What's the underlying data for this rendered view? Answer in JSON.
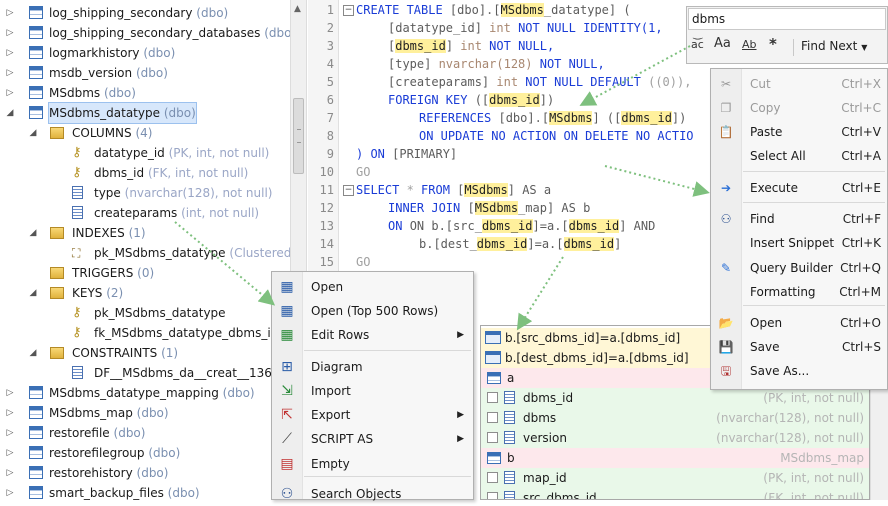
{
  "tree": {
    "rows": [
      {
        "label": "log_shipping_secondary",
        "sub": "(dbo)"
      },
      {
        "label": "log_shipping_secondary_databases",
        "sub": "(dbo)"
      },
      {
        "label": "logmarkhistory",
        "sub": "(dbo)"
      },
      {
        "label": "msdb_version",
        "sub": "(dbo)"
      },
      {
        "label": "MSdbms",
        "sub": "(dbo)"
      },
      {
        "label": "MSdbms_datatype",
        "sub": "(dbo)"
      },
      {
        "label": "COLUMNS",
        "sub": "(4)"
      },
      {
        "label": "datatype_id",
        "sub": "(PK, int, not null)"
      },
      {
        "label": "dbms_id",
        "sub": "(FK, int, not null)"
      },
      {
        "label": "type",
        "sub": "(nvarchar(128), not null)"
      },
      {
        "label": "createparams",
        "sub": "(int, not null)"
      },
      {
        "label": "INDEXES",
        "sub": "(1)"
      },
      {
        "label": "pk_MSdbms_datatype",
        "sub": "(Clustered)"
      },
      {
        "label": "TRIGGERS",
        "sub": "(0)"
      },
      {
        "label": "KEYS",
        "sub": "(2)"
      },
      {
        "label": "pk_MSdbms_datatype",
        "sub": ""
      },
      {
        "label": "fk_MSdbms_datatype_dbms_id",
        "sub": ""
      },
      {
        "label": "CONSTRAINTS",
        "sub": "(1)"
      },
      {
        "label": "DF__MSdbms_da__creat__1367E",
        "sub": ""
      },
      {
        "label": "MSdbms_datatype_mapping",
        "sub": "(dbo)"
      },
      {
        "label": "MSdbms_map",
        "sub": "(dbo)"
      },
      {
        "label": "restorefile",
        "sub": "(dbo)"
      },
      {
        "label": "restorefilegroup",
        "sub": "(dbo)"
      },
      {
        "label": "restorehistory",
        "sub": "(dbo)"
      },
      {
        "label": "smart_backup_files",
        "sub": "(dbo)"
      }
    ]
  },
  "editor": {
    "line_numbers": [
      "1",
      "2",
      "3",
      "4",
      "5",
      "6",
      "7",
      "8",
      "9",
      "10",
      "11",
      "12",
      "13",
      "14",
      "15"
    ],
    "l1": {
      "a": "CREATE TABLE ",
      "b": "[dbo]",
      "c": ".",
      "d": "[",
      "e": "MSdbms",
      "f": "_datatype] ("
    },
    "l2": {
      "a": "[datatype_id] ",
      "b": "int",
      "c": " NOT NULL IDENTITY(1,"
    },
    "l3": {
      "a": "[",
      "b": "dbms_id",
      "c": "] ",
      "d": "int",
      "e": " NOT NULL,"
    },
    "l4": {
      "a": "[type] ",
      "b": "nvarchar(128)",
      "c": " NOT NULL,"
    },
    "l5": {
      "a": "[createparams] ",
      "b": "int",
      "c": " NOT NULL DEFAULT ",
      "d": "((0)),"
    },
    "l6": {
      "a": "FOREIGN KEY ",
      "b": "([",
      "c": "dbms_id",
      "d": "])"
    },
    "l7": {
      "a": "REFERENCES ",
      "b": "[dbo]",
      "c": ".",
      "d": "[",
      "e": "MSdbms",
      "f": "] ([",
      "g": "dbms_id",
      "h": "])"
    },
    "l8": {
      "a": "ON UPDATE NO ACTION ON DELETE NO ACTIO"
    },
    "l9": {
      "a": ") ON ",
      "b": "[PRIMARY]"
    },
    "l10": {
      "a": "GO"
    },
    "l11": {
      "a": "SELECT ",
      "b": "* ",
      "c": "FROM ",
      "d": "[",
      "e": "MSdbms",
      "f": "] AS a"
    },
    "l12": {
      "a": "INNER JOIN ",
      "b": "[",
      "c": "MSdbms",
      "d": "_map] AS b"
    },
    "l13": {
      "a": "ON b.[src_",
      "b": "dbms_id",
      "c": "]=a.[",
      "d": "dbms_id",
      "e": "] AND"
    },
    "l14": {
      "a": "b.[dest_",
      "b": "dbms_id",
      "c": "]=a.[",
      "d": "dbms_id",
      "e": "]"
    },
    "l15": {
      "a": "GO"
    }
  },
  "find": {
    "value": "dbms",
    "match_case_icon": "Aa",
    "whole_word_icon": "Ab",
    "regex_icon": "*",
    "find_next_label": "Find Next"
  },
  "context_menu": [
    {
      "label": "Cut",
      "shortcut": "Ctrl+X",
      "icon": "scissors-icon",
      "disabled": true
    },
    {
      "label": "Copy",
      "shortcut": "Ctrl+C",
      "icon": "copy-icon",
      "disabled": true
    },
    {
      "label": "Paste",
      "shortcut": "Ctrl+V",
      "icon": "paste-icon",
      "disabled": false
    },
    {
      "label": "Select All",
      "shortcut": "Ctrl+A",
      "icon": "",
      "disabled": false
    },
    {
      "label": "Execute",
      "shortcut": "Ctrl+E",
      "icon": "execute-icon",
      "disabled": false
    },
    {
      "label": "Find",
      "shortcut": "Ctrl+F",
      "icon": "binoculars-icon",
      "disabled": false
    },
    {
      "label": "Insert Snippet",
      "shortcut": "Ctrl+K",
      "icon": "",
      "disabled": false
    },
    {
      "label": "Query Builder",
      "shortcut": "Ctrl+Q",
      "icon": "query-builder-icon",
      "disabled": false
    },
    {
      "label": "Formatting",
      "shortcut": "Ctrl+M",
      "icon": "",
      "disabled": false
    },
    {
      "label": "Open",
      "shortcut": "Ctrl+O",
      "icon": "folder-icon",
      "disabled": false
    },
    {
      "label": "Save",
      "shortcut": "Ctrl+S",
      "icon": "save-icon",
      "disabled": false
    },
    {
      "label": "Save As...",
      "shortcut": "",
      "icon": "save-as-icon",
      "disabled": false
    }
  ],
  "table_menu": [
    {
      "label": "Open",
      "icon": "open-table-icon",
      "submenu": false
    },
    {
      "label": "Open (Top 500 Rows)",
      "icon": "open-top-rows-icon",
      "submenu": false
    },
    {
      "label": "Edit Rows",
      "icon": "edit-rows-icon",
      "submenu": true
    },
    {
      "label": "Diagram",
      "icon": "diagram-icon",
      "submenu": false
    },
    {
      "label": "Import",
      "icon": "import-icon",
      "submenu": false
    },
    {
      "label": "Export",
      "icon": "export-icon",
      "submenu": true
    },
    {
      "label": "SCRIPT AS",
      "icon": "script-icon",
      "submenu": true
    },
    {
      "label": "Empty",
      "icon": "empty-table-icon",
      "submenu": false
    },
    {
      "label": "Search Objects",
      "icon": "search-objects-icon",
      "submenu": false
    }
  ],
  "join_popup": {
    "conditions": [
      "b.[src_dbms_id]=a.[dbms_id]",
      "b.[dest_dbms_id]=a.[dbms_id]"
    ],
    "tables": [
      {
        "alias": "a",
        "name": "",
        "columns": [
          {
            "name": "dbms_id",
            "type": "(PK, int, not null)"
          },
          {
            "name": "dbms",
            "type": "(nvarchar(128), not null)"
          },
          {
            "name": "version",
            "type": "(nvarchar(128), not null)"
          }
        ]
      },
      {
        "alias": "b",
        "name": "MSdbms_map",
        "columns": [
          {
            "name": "map_id",
            "type": "(PK, int, not null)"
          },
          {
            "name": "src_dbms_id",
            "type": "(FK, int, not null)"
          }
        ]
      }
    ]
  },
  "colors": {
    "keyword": "#1a3cd6",
    "highlight": "#fff09c",
    "arrow": "#7ec07e"
  }
}
